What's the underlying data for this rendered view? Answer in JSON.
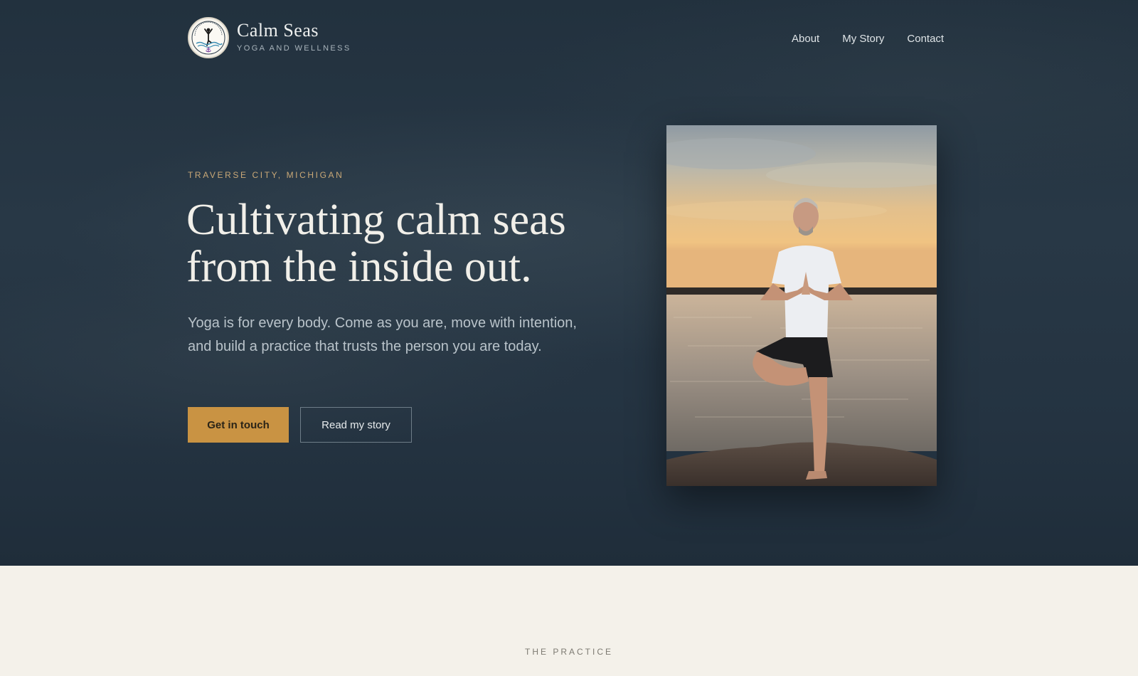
{
  "brand": {
    "name": "Calm Seas",
    "tagline": "YOGA AND WELLNESS",
    "logo_icon": "lotus-logo-icon"
  },
  "nav": {
    "items": [
      {
        "label": "About"
      },
      {
        "label": "My Story"
      },
      {
        "label": "Contact"
      }
    ]
  },
  "hero": {
    "eyebrow": "TRAVERSE CITY, MICHIGAN",
    "headline_line1": "Cultivating calm seas",
    "headline_line2": "from the inside out.",
    "lede": "Yoga is for every body. Come as you are, move with intention, and build a practice that trusts the person you are today.",
    "primary_button": "Get in touch",
    "secondary_button": "Read my story",
    "photo_icon": "yoga-tree-pose-photo"
  },
  "practice": {
    "eyebrow": "THE PRACTICE"
  },
  "colors": {
    "hero_bg": "#243341",
    "accent": "#c99343",
    "eyebrow": "#c9a877",
    "page_bg": "#f4f1ea"
  }
}
